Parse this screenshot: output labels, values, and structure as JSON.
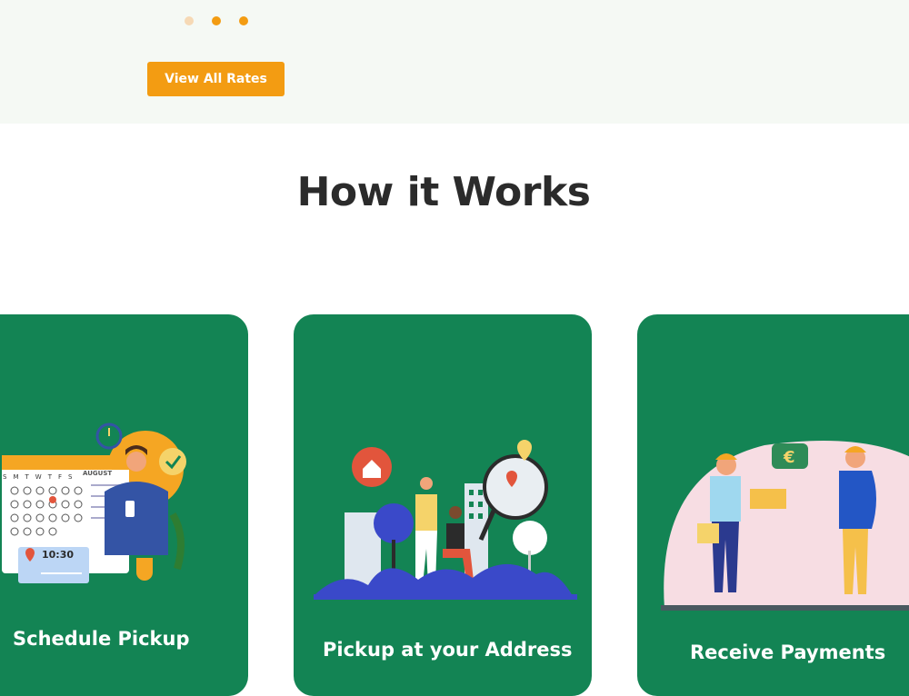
{
  "carousel": {
    "dots": [
      {
        "state": "inactive"
      },
      {
        "state": "active"
      },
      {
        "state": "active"
      }
    ],
    "cta_label": "View All Rates"
  },
  "how_it_works": {
    "title": "How it Works",
    "steps": [
      {
        "label": "Schedule Pickup",
        "illustration": "calendar-scheduling-illustration",
        "calendar_month": "AUGUST",
        "calendar_weekdays": [
          "S",
          "M",
          "T",
          "W",
          "T",
          "F",
          "S"
        ],
        "clock_time": "10:30"
      },
      {
        "label": "Pickup at your Address",
        "illustration": "map-location-pickup-illustration"
      },
      {
        "label": "Receive Payments",
        "illustration": "courier-payment-illustration",
        "currency_symbol": "€"
      }
    ]
  },
  "colors": {
    "accent_orange": "#f39c12",
    "card_green": "#138454",
    "heading_dark": "#2b2b2b",
    "band_bg": "#f5f9f4"
  }
}
